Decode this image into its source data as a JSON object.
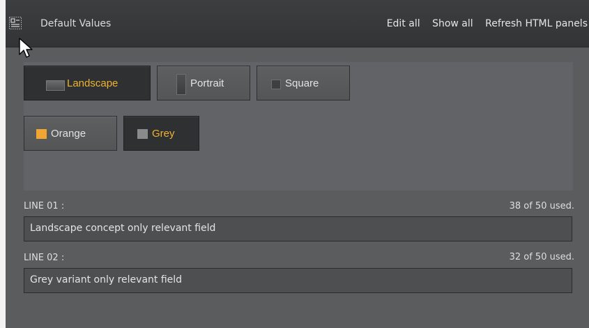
{
  "header": {
    "title": "Default Values",
    "links": [
      "Edit all",
      "Show all",
      "Refresh HTML panels"
    ]
  },
  "concept_buttons": [
    {
      "label": "Landscape",
      "selected": true
    },
    {
      "label": "Portrait",
      "selected": false
    },
    {
      "label": "Square",
      "selected": false
    }
  ],
  "variant_buttons": [
    {
      "label": "Orange",
      "selected": false,
      "swatch": "#f0a630"
    },
    {
      "label": "Grey",
      "selected": true,
      "swatch": "#8a8b8d"
    }
  ],
  "fields": [
    {
      "label": "LINE 01 :",
      "count": "38 of 50 used.",
      "value": "Landscape concept only relevant field"
    },
    {
      "label": "LINE 02 :",
      "count": "32 of 50 used.",
      "value": "Grey variant only relevant field"
    }
  ],
  "colors": {
    "accent": "#f0b232",
    "panel": "#5b5c5e",
    "header": "#37383a"
  }
}
